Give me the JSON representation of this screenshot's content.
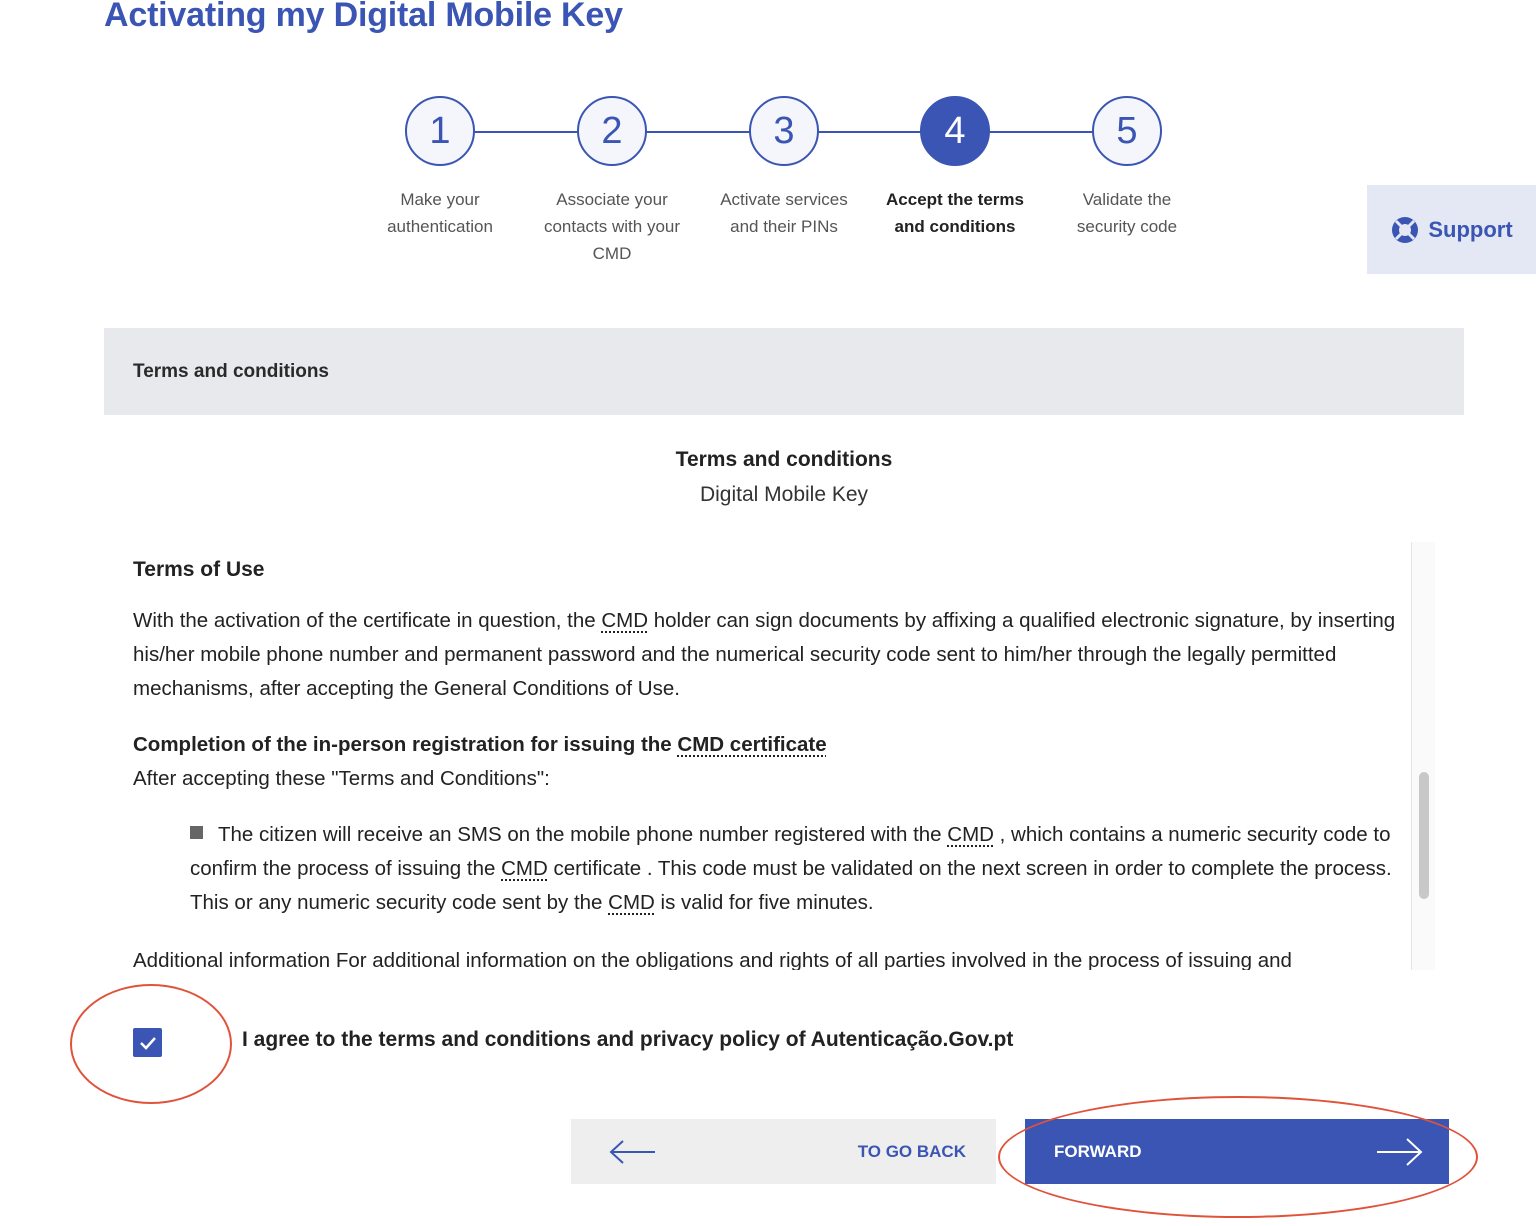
{
  "page": {
    "title": "Activating my Digital Mobile Key"
  },
  "stepper": {
    "steps": [
      {
        "number": "1",
        "label_l1": "Make your",
        "label_l2": "authentication",
        "label_l3": ""
      },
      {
        "number": "2",
        "label_l1": "Associate your",
        "label_l2": "contacts with your",
        "label_l3": "CMD"
      },
      {
        "number": "3",
        "label_l1": "Activate services",
        "label_l2": "and their PINs",
        "label_l3": ""
      },
      {
        "number": "4",
        "label_l1": "Accept the terms",
        "label_l2": "and conditions",
        "label_l3": ""
      },
      {
        "number": "5",
        "label_l1": "Validate the",
        "label_l2": "security code",
        "label_l3": ""
      }
    ],
    "active_step": 4
  },
  "support": {
    "label": "Support",
    "icon": "lifebuoy-icon"
  },
  "section": {
    "heading": "Terms and conditions"
  },
  "document": {
    "title": "Terms and conditions",
    "subtitle": "Digital Mobile Key",
    "terms_heading": "Terms of Use",
    "p1_a": "With the activation of the certificate in question, the ",
    "cmd": "CMD",
    "p1_b": " holder can sign documents by affixing a qualified electronic signature, by inserting his/her mobile phone number and permanent password and the numerical security code sent to him/her through the legally permitted mechanisms, after accepting the General Conditions of Use.",
    "completion_heading_a": "Completion of the in-person registration for issuing the ",
    "completion_heading_b": "CMD certificate",
    "after_accepting": "After accepting these \"Terms and Conditions\":",
    "bullet_a": "The citizen will receive an SMS on the mobile phone number registered with the ",
    "bullet_b": " , which contains a numeric security code to confirm the process of issuing the ",
    "bullet_c": " certificate . This code must be validated on the next screen in order to complete the process. This or any numeric security code sent by the ",
    "bullet_d": " is valid for five minutes.",
    "cutoff_line": "Additional information For additional information on the obligations and rights of all parties involved in the process of issuing and"
  },
  "agree": {
    "checked": true,
    "label": "I agree to the terms and conditions and privacy policy of  Autenticação.Gov.pt"
  },
  "buttons": {
    "back": "TO GO BACK",
    "forward": "FORWARD"
  },
  "colors": {
    "accent": "#3a55b3",
    "annotation": "#e0533a",
    "section_bg": "#e8e9ec"
  }
}
